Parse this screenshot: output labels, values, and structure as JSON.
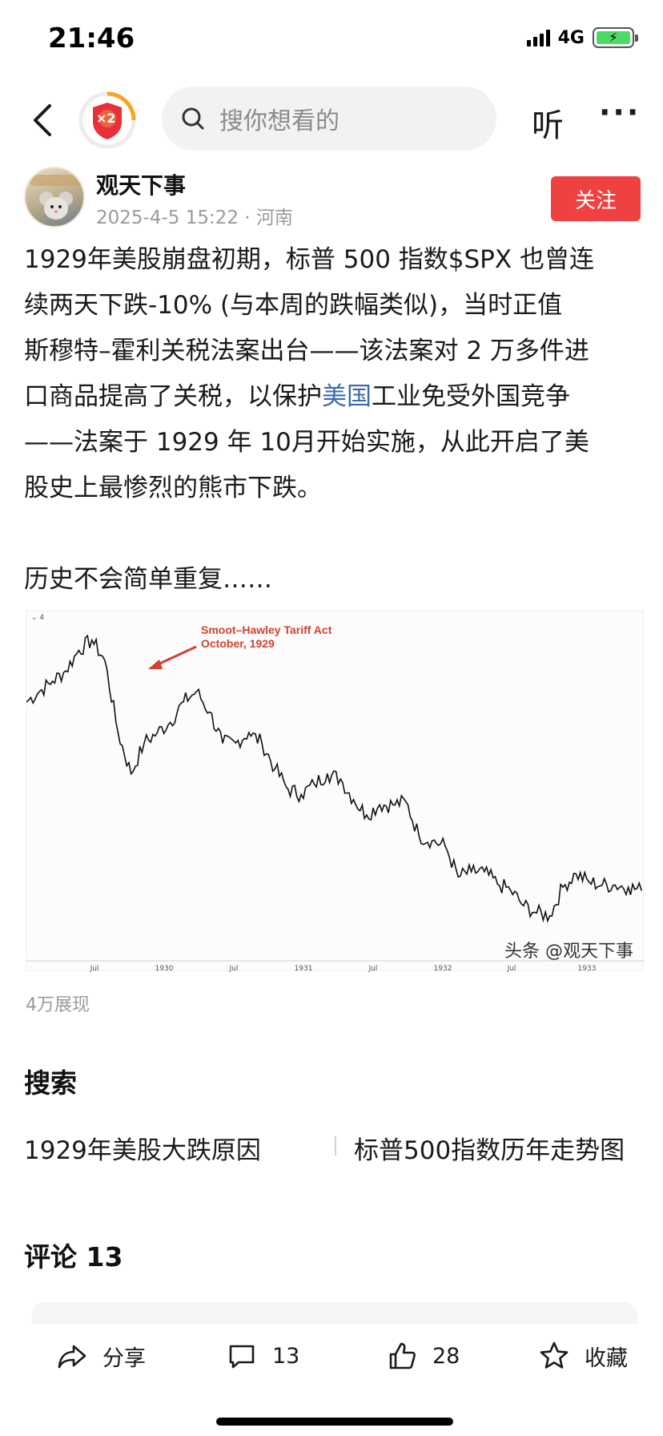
{
  "status_bar": {
    "time": "21:46",
    "network": "4G",
    "battery_color": "#4cd964"
  },
  "nav": {
    "badge_text": "×2",
    "search_placeholder": "搜你想看的",
    "listen_label": "听",
    "more_label": "···"
  },
  "author": {
    "name": "观天下事",
    "meta": "2025-4-5 15:22 · 河南",
    "follow_label": "关注",
    "follow_color": "#f04142"
  },
  "article": {
    "lines": [
      "1929年美股崩盘初期，标普 500 指数$SPX 也曾连",
      "续两天下跌-10% (与本周的跌幅类似)，当时正值",
      "斯穆特–霍利关税法案出台——该法案对 2 万多件进",
      "口商品提高了关税，以保护",
      "美国",
      "工业免受外国竞争",
      "——法案于 1929 年 10月开始实施，从此开启了美",
      "股史上最惨烈的熊市下跌。"
    ],
    "closing": "历史不会简单重复……",
    "link_color": "#3d6aa8"
  },
  "chart_data": {
    "type": "line",
    "annotation": [
      "Smoot–Hawley Tariff Act",
      "October, 1929"
    ],
    "corner_label": "4",
    "x_ticks": [
      "Jul",
      "1930",
      "Jul",
      "1931",
      "Jul",
      "1932",
      "Jul",
      "1933"
    ],
    "watermark": "头条 @观天下事",
    "y_ticks": [],
    "series": [
      {
        "x": [
          "1929-04",
          "1929-05",
          "1929-06",
          "1929-07",
          "1929-08",
          "1929-09",
          "1929-10",
          "1929-10b",
          "1929-11",
          "1929-12",
          "1930-01",
          "1930-02",
          "1930-03",
          "1930-04",
          "1930-05",
          "1930-06",
          "1930-07",
          "1930-08",
          "1930-09",
          "1930-10",
          "1930-11",
          "1930-12",
          "1931-01",
          "1931-02",
          "1931-03",
          "1931-04",
          "1931-05",
          "1931-06",
          "1931-07",
          "1931-08",
          "1931-09",
          "1931-10",
          "1931-11",
          "1931-12",
          "1932-01",
          "1932-02",
          "1932-03",
          "1932-04",
          "1932-05",
          "1932-06",
          "1932-07",
          "1932-08",
          "1932-09",
          "1932-10",
          "1932-11",
          "1932-12",
          "1933-01",
          "1933-02"
        ],
        "y": [
          25,
          26,
          27,
          28,
          30,
          31,
          29,
          22,
          18,
          21,
          22,
          23,
          25,
          26,
          24,
          21,
          21,
          22,
          21,
          18.5,
          16.5,
          16,
          17,
          18,
          17.5,
          15.5,
          14,
          15,
          15,
          15.3,
          12,
          11.5,
          11,
          8,
          8.5,
          8.5,
          7.3,
          6.7,
          5.2,
          4.5,
          4.2,
          7,
          8.3,
          7.5,
          7.2,
          7.2,
          7.0,
          6.7
        ]
      }
    ]
  },
  "views": "4万展现",
  "search_section": {
    "title": "搜索",
    "suggestions": [
      "1929年美股大跌原因",
      "标普500指数历年走势图"
    ]
  },
  "comments": {
    "title": "评论 13"
  },
  "bottom_bar": {
    "share": "分享",
    "comment_count": "13",
    "like_count": "28",
    "favorite": "收藏"
  }
}
